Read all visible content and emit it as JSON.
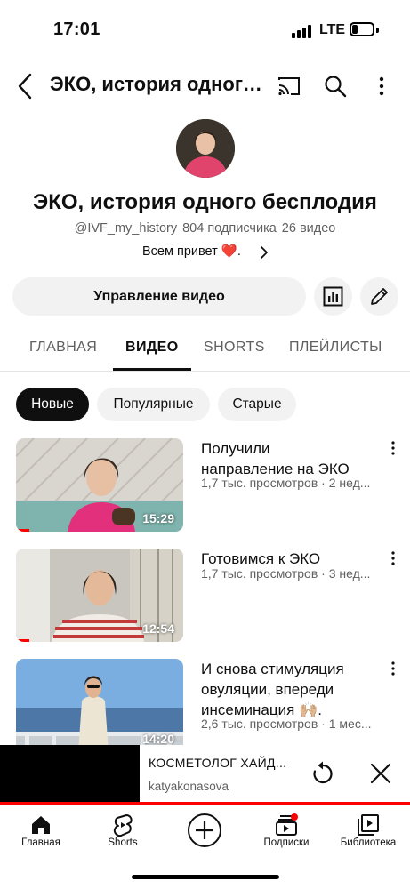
{
  "status_bar": {
    "time": "17:01",
    "network": "LTE"
  },
  "header": {
    "title": "ЭКО, история одного бесплодия"
  },
  "channel": {
    "name": "ЭКО, история одного бесплодия",
    "handle": "@IVF_my_history",
    "subscribers": "804 подписчика",
    "videos_count": "26 видео",
    "description": "Всем привет ❤️."
  },
  "actions": {
    "manage_label": "Управление видео"
  },
  "tabs": [
    "ГЛАВНАЯ",
    "ВИДЕО",
    "SHORTS",
    "ПЛЕЙЛИСТЫ"
  ],
  "active_tab": "ВИДЕО",
  "filters": [
    "Новые",
    "Популярные",
    "Старые"
  ],
  "active_filter": "Новые",
  "videos": [
    {
      "title_line1": "Получили",
      "title_line2": "направление на ЭКО",
      "title_line3": "",
      "meta": "1,7 тыс. просмотров · 2 нед...",
      "duration": "15:29",
      "progress": 0.08
    },
    {
      "title_line1": "Готовимся к ЭКО",
      "title_line2": "",
      "title_line3": "",
      "meta": "1,7 тыс. просмотров · 3 нед...",
      "duration": "12:54",
      "progress": 0.08
    },
    {
      "title_line1": "И снова стимуляция",
      "title_line2": "овуляции, впереди",
      "title_line3": "инсеминация 🙌🏼.",
      "meta": "2,6 тыс. просмотров · 1 мес...",
      "duration": "14:20",
      "progress": 0
    }
  ],
  "miniplayer": {
    "title": "КОСМЕТОЛОГ ХАЙД...",
    "channel": "katyakonasova",
    "progress": 1.0
  },
  "bottom_nav": [
    {
      "label": "Главная",
      "icon": "home-icon"
    },
    {
      "label": "Shorts",
      "icon": "shorts-icon"
    },
    {
      "label": "",
      "icon": "create-icon"
    },
    {
      "label": "Подписки",
      "icon": "subscriptions-icon"
    },
    {
      "label": "Библиотека",
      "icon": "library-icon"
    }
  ],
  "colors": {
    "accent": "#ff0000",
    "text": "#0f0f0f",
    "muted": "#606060",
    "chip_bg": "#f2f2f2"
  }
}
